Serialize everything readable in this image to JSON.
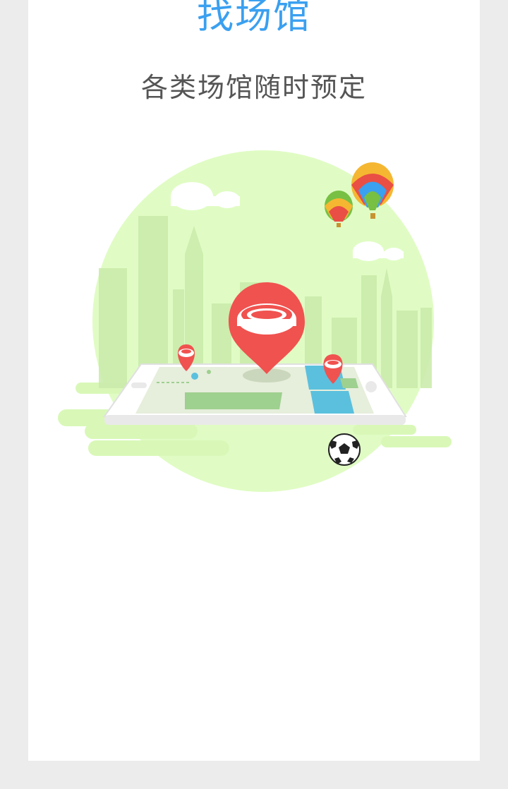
{
  "page": {
    "title": "找场馆",
    "subtitle": "各类场馆随时预定"
  },
  "illustration": {
    "colors": {
      "background_circle": "#e0fcc4",
      "skyline": "#c9ebaa",
      "pin": "#f0524f",
      "title": "#3aa0f0",
      "map_green": "#9ed08f",
      "map_blue": "#5bc0de"
    },
    "elements": [
      "hot-air-balloon-icon",
      "location-pin-icon",
      "stadium-icon",
      "smartphone-map-icon",
      "soccer-ball-icon",
      "cloud-icon",
      "city-skyline"
    ]
  }
}
